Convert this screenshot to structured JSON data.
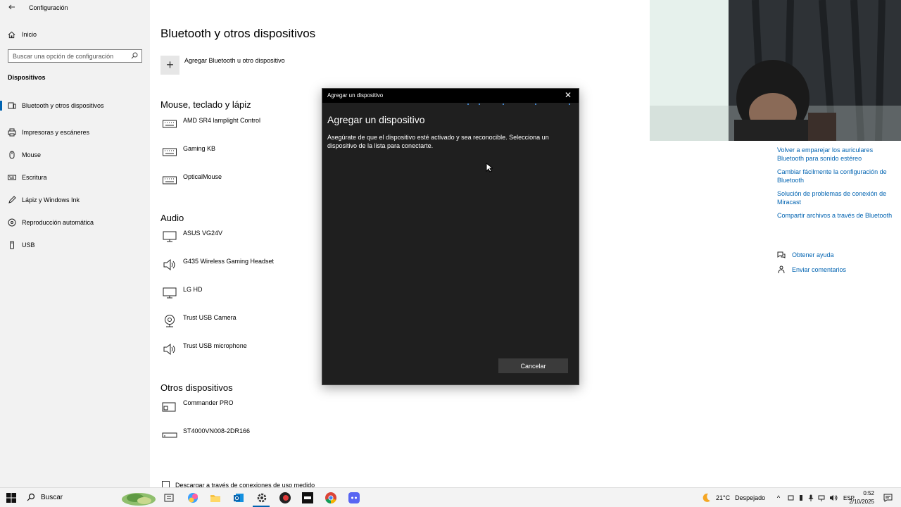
{
  "window": {
    "title": "Configuración",
    "back_icon": "back-arrow-icon"
  },
  "sidebar": {
    "home_label": "Inicio",
    "search_placeholder": "Buscar una opción de configuración",
    "section": "Dispositivos",
    "items": [
      {
        "label": "Bluetooth y otros dispositivos",
        "icon": "bluetooth-devices-icon",
        "active": true
      },
      {
        "label": "Impresoras y escáneres",
        "icon": "printer-icon"
      },
      {
        "label": "Mouse",
        "icon": "mouse-icon"
      },
      {
        "label": "Escritura",
        "icon": "keyboard-icon"
      },
      {
        "label": "Lápiz y Windows Ink",
        "icon": "pen-icon"
      },
      {
        "label": "Reproducción automática",
        "icon": "autoplay-icon"
      },
      {
        "label": "USB",
        "icon": "usb-icon"
      }
    ]
  },
  "main": {
    "title": "Bluetooth y otros dispositivos",
    "add_label": "Agregar Bluetooth u otro dispositivo",
    "groups": {
      "input": {
        "title": "Mouse, teclado y lápiz",
        "devices": [
          "AMD SR4 lamplight Control",
          "Gaming KB",
          "OpticalMouse"
        ]
      },
      "audio": {
        "title": "Audio",
        "devices": [
          "ASUS VG24V",
          "G435 Wireless Gaming Headset",
          "LG HD",
          "Trust USB Camera",
          "Trust USB microphone"
        ]
      },
      "other": {
        "title": "Otros dispositivos",
        "devices": [
          "Commander PRO",
          "ST4000VN008-2DR166"
        ]
      }
    },
    "metered_label": "Descargar a través de conexiones de uso medido"
  },
  "related_links": [
    "Volver a emparejar los auriculares Bluetooth para sonido estéreo",
    "Cambiar fácilmente la configuración de Bluetooth",
    "Solución de problemas de conexión de Miracast",
    "Compartir archivos a través de Bluetooth"
  ],
  "help": {
    "get_help": "Obtener ayuda",
    "feedback": "Enviar comentarios"
  },
  "dialog": {
    "title": "Agregar un dispositivo",
    "heading": "Agregar un dispositivo",
    "body": "Asegúrate de que el dispositivo esté activado y sea reconocible. Selecciona un dispositivo de la lista para conectarte.",
    "cancel": "Cancelar",
    "accent": "#4ea3ff"
  },
  "taskbar": {
    "search": "Buscar",
    "weather": "21°C",
    "weather_desc": "Despejado",
    "lang": "ESP",
    "time": "0:52",
    "date": "2/10/2025"
  }
}
